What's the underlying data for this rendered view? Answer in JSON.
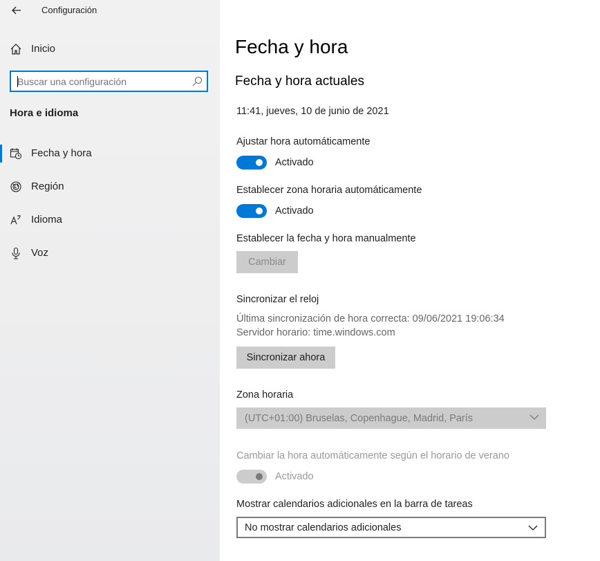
{
  "window": {
    "title": "Configuración"
  },
  "sidebar": {
    "home_label": "Inicio",
    "search_placeholder": "Buscar una configuración",
    "section_title": "Hora e idioma",
    "items": [
      {
        "label": "Fecha y hora",
        "icon": "calendar-clock-icon",
        "active": true
      },
      {
        "label": "Región",
        "icon": "globe-icon",
        "active": false
      },
      {
        "label": "Idioma",
        "icon": "language-icon",
        "active": false
      },
      {
        "label": "Voz",
        "icon": "microphone-icon",
        "active": false
      }
    ]
  },
  "main": {
    "page_title": "Fecha y hora",
    "section_title": "Fecha y hora actuales",
    "current_datetime": "11:41, jueves, 10 de junio de 2021",
    "auto_time": {
      "label": "Ajustar hora automáticamente",
      "state": "Activado",
      "on": true
    },
    "auto_timezone": {
      "label": "Establecer zona horaria automáticamente",
      "state": "Activado",
      "on": true
    },
    "manual": {
      "label": "Establecer la fecha y hora manualmente",
      "button": "Cambiar"
    },
    "sync": {
      "title": "Sincronizar el reloj",
      "last_sync": "Última sincronización de hora correcta: 09/06/2021 19:06:34",
      "server": "Servidor horario: time.windows.com",
      "button": "Sincronizar ahora"
    },
    "timezone": {
      "label": "Zona horaria",
      "value": "(UTC+01:00) Bruselas, Copenhague, Madrid, París"
    },
    "dst": {
      "label": "Cambiar la hora automáticamente según el horario de verano",
      "state": "Activado",
      "on": true,
      "disabled": true
    },
    "calendars": {
      "label": "Mostrar calendarios adicionales en la barra de tareas",
      "value": "No mostrar calendarios adicionales"
    }
  },
  "colors": {
    "accent": "#0078d7",
    "disabled": "#cccccc"
  }
}
